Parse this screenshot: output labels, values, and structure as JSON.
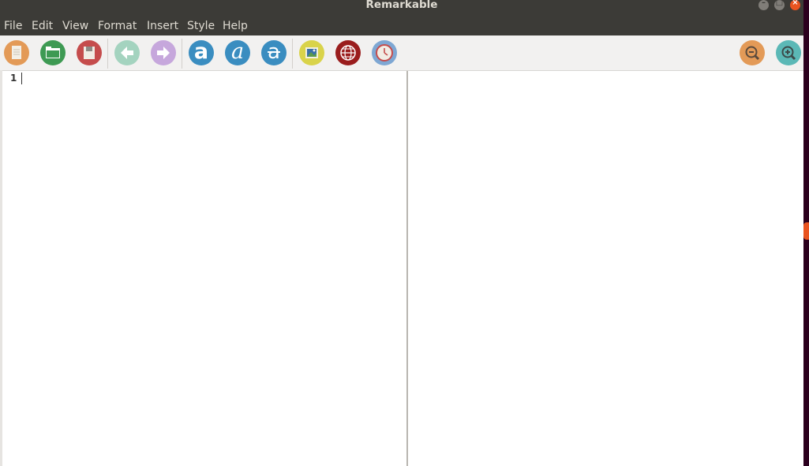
{
  "window": {
    "title": "Remarkable"
  },
  "menu": [
    "File",
    "Edit",
    "View",
    "Format",
    "Insert",
    "Style",
    "Help"
  ],
  "toolbar": {
    "new_label": "New",
    "open_label": "Open",
    "save_label": "Save",
    "undo_label": "Undo",
    "redo_label": "Redo",
    "bold_glyph": "a",
    "italic_glyph": "a",
    "strike_glyph": "a",
    "colors": {
      "new": "#e39a57",
      "open": "#3e9a53",
      "save": "#c54c4c",
      "undo": "#a4d3bf",
      "redo": "#c6a7dc",
      "format": "#3a8dc0",
      "image": "#d9d34a",
      "link": "#9a1d1d",
      "timestamp": "#7ea7d3",
      "zoom_out": "#e39a57",
      "zoom_in": "#5bb8b6"
    }
  },
  "editor": {
    "line_numbers": [
      "1"
    ],
    "content": ""
  }
}
